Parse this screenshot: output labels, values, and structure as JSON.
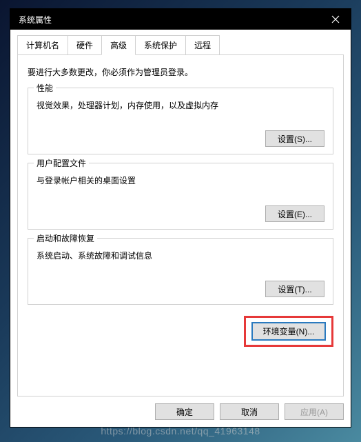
{
  "titlebar": {
    "title": "系统属性"
  },
  "tabs": {
    "items": [
      {
        "label": "计算机名"
      },
      {
        "label": "硬件"
      },
      {
        "label": "高级"
      },
      {
        "label": "系统保护"
      },
      {
        "label": "远程"
      }
    ]
  },
  "intro": "要进行大多数更改，你必须作为管理员登录。",
  "groups": {
    "performance": {
      "title": "性能",
      "desc": "视觉效果，处理器计划，内存使用，以及虚拟内存",
      "button": "设置(S)..."
    },
    "profiles": {
      "title": "用户配置文件",
      "desc": "与登录帐户相关的桌面设置",
      "button": "设置(E)..."
    },
    "startup": {
      "title": "启动和故障恢复",
      "desc": "系统启动、系统故障和调试信息",
      "button": "设置(T)..."
    }
  },
  "env_button": "环境变量(N)...",
  "dialog": {
    "ok": "确定",
    "cancel": "取消",
    "apply": "应用(A)"
  },
  "watermark": "https://blog.csdn.net/qq_41963148"
}
